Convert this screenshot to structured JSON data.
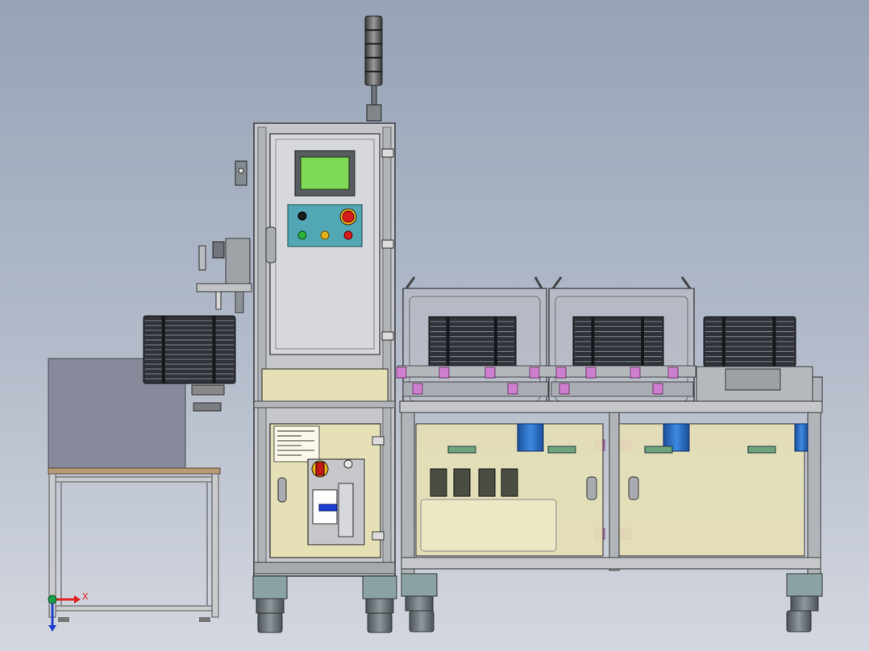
{
  "viewport": {
    "background_top": "#96a3b6",
    "background_bottom": "#d3d7df"
  },
  "triad": {
    "x_label": "X",
    "x_color": "#e0221d",
    "y_color": "#1aa04a",
    "z_color": "#1c3ed0"
  },
  "control_panel": {
    "screen_color": "#7ed957",
    "estop_color": "#d71c1c",
    "lamp_colors": [
      "#2bb33d",
      "#e3b21b",
      "#d71c1c"
    ],
    "panel_color": "#52a7b4"
  },
  "tower_light": {
    "segments": 5
  },
  "colors": {
    "frame": "#c5c7cb",
    "lower_panel": "#e5e0b5",
    "motor": "#2a6fc9",
    "bracket": "#cf7fd0",
    "stack": "#2f3238"
  }
}
